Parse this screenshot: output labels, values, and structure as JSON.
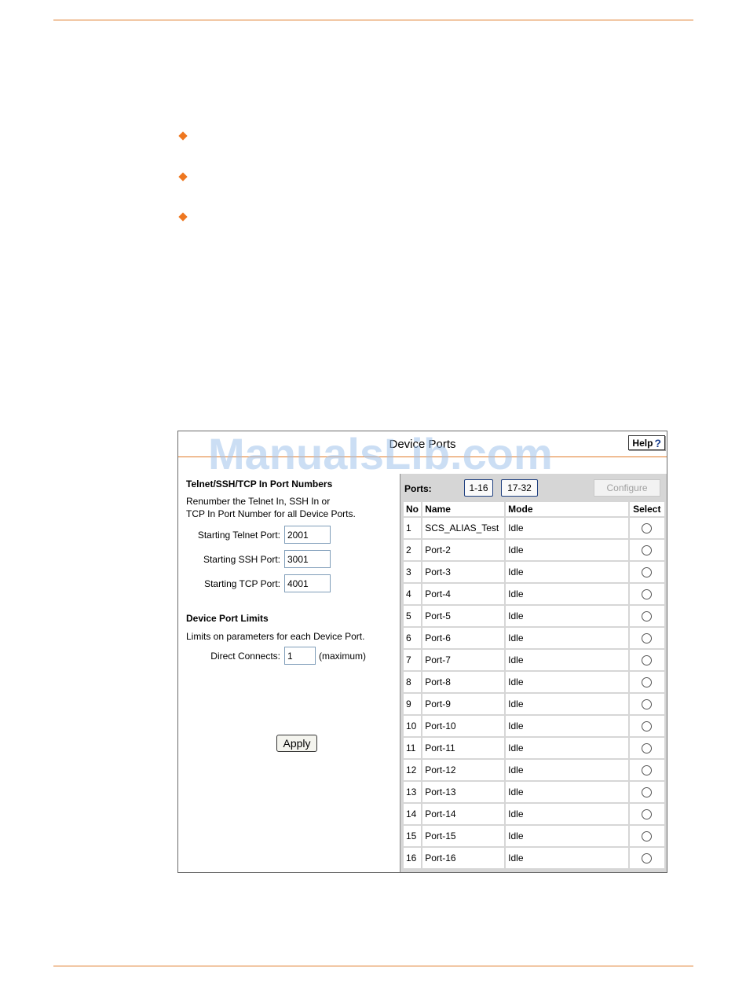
{
  "watermark": "ManualsLib.com",
  "panel": {
    "title": "Device Ports",
    "help_label": "Help",
    "help_icon": "?"
  },
  "left": {
    "section1_title": "Telnet/SSH/TCP In Port Numbers",
    "section1_desc_line1": "Renumber the Telnet In, SSH In or",
    "section1_desc_line2": "TCP In Port Number for all Device Ports.",
    "telnet_label": "Starting Telnet Port:",
    "telnet_value": "2001",
    "ssh_label": "Starting SSH Port:",
    "ssh_value": "3001",
    "tcp_label": "Starting TCP Port:",
    "tcp_value": "4001",
    "section2_title": "Device Port Limits",
    "section2_desc": "Limits on parameters for each Device Port.",
    "direct_label": "Direct Connects:",
    "direct_value": "1",
    "direct_suffix": "(maximum)",
    "apply_label": "Apply"
  },
  "right": {
    "ports_label": "Ports:",
    "range1": "1-16",
    "range2": "17-32",
    "configure_label": "Configure",
    "headers": {
      "no": "No",
      "name": "Name",
      "mode": "Mode",
      "select": "Select"
    },
    "rows": [
      {
        "no": "1",
        "name": "SCS_ALIAS_Test",
        "mode": "Idle"
      },
      {
        "no": "2",
        "name": "Port-2",
        "mode": "Idle"
      },
      {
        "no": "3",
        "name": "Port-3",
        "mode": "Idle"
      },
      {
        "no": "4",
        "name": "Port-4",
        "mode": "Idle"
      },
      {
        "no": "5",
        "name": "Port-5",
        "mode": "Idle"
      },
      {
        "no": "6",
        "name": "Port-6",
        "mode": "Idle"
      },
      {
        "no": "7",
        "name": "Port-7",
        "mode": "Idle"
      },
      {
        "no": "8",
        "name": "Port-8",
        "mode": "Idle"
      },
      {
        "no": "9",
        "name": "Port-9",
        "mode": "Idle"
      },
      {
        "no": "10",
        "name": "Port-10",
        "mode": "Idle"
      },
      {
        "no": "11",
        "name": "Port-11",
        "mode": "Idle"
      },
      {
        "no": "12",
        "name": "Port-12",
        "mode": "Idle"
      },
      {
        "no": "13",
        "name": "Port-13",
        "mode": "Idle"
      },
      {
        "no": "14",
        "name": "Port-14",
        "mode": "Idle"
      },
      {
        "no": "15",
        "name": "Port-15",
        "mode": "Idle"
      },
      {
        "no": "16",
        "name": "Port-16",
        "mode": "Idle"
      }
    ]
  },
  "colors": {
    "rule": "#e07a28",
    "bullet": "#ee7720",
    "table_bg": "#d6d6d6"
  }
}
